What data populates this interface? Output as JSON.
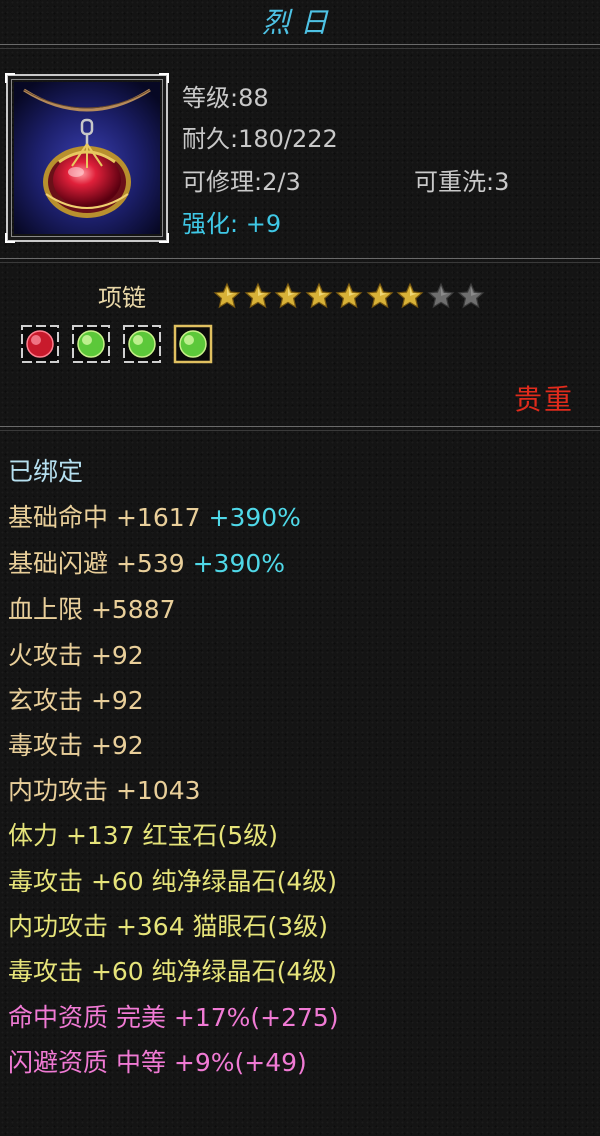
{
  "item": {
    "name": "烈日",
    "level_text": "等级:88",
    "durability_text": "耐久:180/222",
    "repair_text": "可修理:2/3",
    "rewash_text": "可重洗:3",
    "enhance_text": "强化: +9",
    "slot": "项链",
    "rarity": "贵重",
    "icon": "red-gem-necklace-icon",
    "stars": {
      "filled": 7,
      "total": 9
    },
    "gems": [
      "red-gem-icon",
      "green-gem-icon",
      "green-gem-icon",
      "green-gem-icon"
    ]
  },
  "stats": {
    "bound": "已绑定",
    "hit": {
      "label": "基础命中",
      "value": "+1617",
      "percent": "+390%"
    },
    "dodge": {
      "label": "基础闪避",
      "value": "+539",
      "percent": "+390%"
    },
    "hp": "血上限 +5887",
    "fire": "火攻击 +92",
    "xuan": "玄攻击 +92",
    "poison": "毒攻击 +92",
    "internal": "内功攻击 +1043",
    "gem1": "体力 +137 红宝石(5级)",
    "gem2": "毒攻击 +60 纯净绿晶石(4级)",
    "gem3": "内功攻击 +364 猫眼石(3级)",
    "gem4": "毒攻击 +60 纯净绿晶石(4级)",
    "aptitude_hit": "命中资质 完美 +17%(+275)",
    "aptitude_dodge": "闪避资质 中等 +9%(+49)"
  },
  "colors": {
    "title": "#4ec2e4",
    "enhance": "#3fc8e6",
    "rarity": "#e02b1c",
    "base_stat": "#e9cf9a",
    "percent": "#4fd8e8",
    "gem_stat": "#e6e47a",
    "aptitude": "#f07ad4"
  }
}
